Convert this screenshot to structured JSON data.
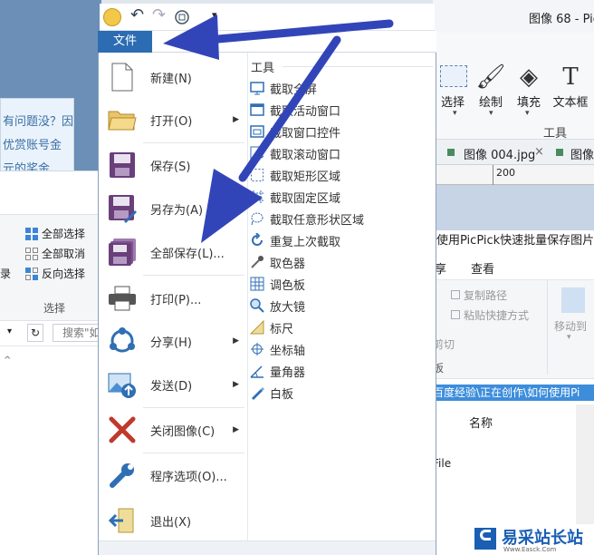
{
  "bg_left": {
    "panel_lines": [
      "有问题没？因",
      "优赏账号金",
      "元的奖金"
    ],
    "select_items": [
      "全部选择",
      "全部取消",
      "反向选择"
    ],
    "select_group": "选择",
    "edge_label": "录",
    "search_placeholder": "搜索\"如",
    "nav_glyph": "^"
  },
  "qat": {
    "undo": "↶",
    "redo": "↷",
    "dropdown": "▾"
  },
  "file_tab": "文件",
  "menu_items": [
    {
      "label": "新建(N)",
      "arrow": ""
    },
    {
      "label": "打开(O)",
      "arrow": "▶"
    },
    {
      "label": "保存(S)",
      "arrow": ""
    },
    {
      "label": "另存为(A)",
      "arrow": ""
    },
    {
      "label": "全部保存(L)...",
      "arrow": ""
    },
    {
      "label": "打印(P)...",
      "arrow": ""
    },
    {
      "label": "分享(H)",
      "arrow": "▶"
    },
    {
      "label": "发送(D)",
      "arrow": "▶"
    },
    {
      "label": "关闭图像(C)",
      "arrow": "▶"
    },
    {
      "label": "程序选项(O)...",
      "arrow": ""
    },
    {
      "label": "退出(X)",
      "arrow": ""
    }
  ],
  "tools": {
    "title": "工具",
    "items": [
      "截取全屏",
      "截取活动窗口",
      "截取窗口控件",
      "截取滚动窗口",
      "截取矩形区域",
      "截取固定区域",
      "截取任意形状区域",
      "重复上次截取",
      "取色器",
      "调色板",
      "放大镜",
      "标尺",
      "坐标轴",
      "量角器",
      "白板"
    ]
  },
  "right_app": {
    "title": "图像 68 - Pic",
    "ribbon_tools": [
      "选择",
      "绘制",
      "填充",
      "文本框"
    ],
    "group_label": "工具",
    "tab_label": "图像 004.jpg",
    "tab_close": "×",
    "tab_next": "图像",
    "ruler_mark": "200"
  },
  "right_explorer": {
    "title": "使用PicPick快速批量保存图片？",
    "menu_items": [
      "享",
      "查看"
    ],
    "copy_path": "复制路径",
    "paste_shortcut": "粘贴快捷方式",
    "move_to": "移动到",
    "cut_fragment": "剪切",
    "board_fragment": "板",
    "path": "百度经验\\正在创作\\如何使用Pi",
    "col_name": "名称",
    "file_fragment": "File"
  },
  "watermark": {
    "text": "易采站长站",
    "sub": "Www.Easck.Com"
  },
  "colors": {
    "accent": "#2c6cb3",
    "arrow": "#3245b8"
  }
}
